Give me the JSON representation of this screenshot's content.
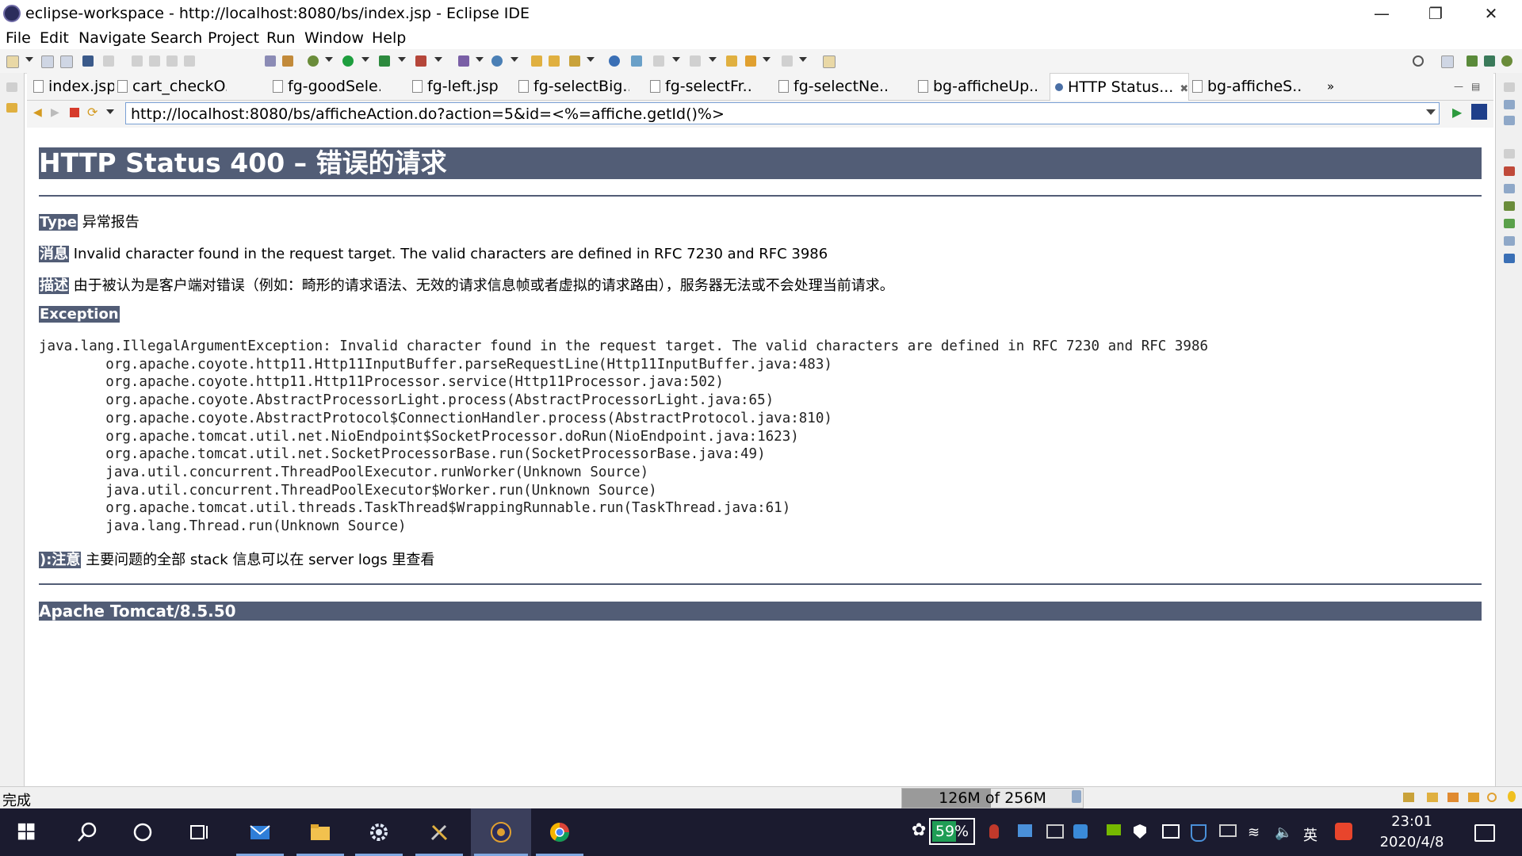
{
  "window": {
    "title": "eclipse-workspace - http://localhost:8080/bs/index.jsp - Eclipse IDE"
  },
  "menu": [
    "File",
    "Edit",
    "Navigate",
    "Search",
    "Project",
    "Run",
    "Window",
    "Help"
  ],
  "tabs": [
    {
      "label": "index.jsp",
      "active": false
    },
    {
      "label": "cart_checkO...",
      "active": false
    },
    {
      "label": "fg-goodSele...",
      "active": false
    },
    {
      "label": "fg-left.jsp",
      "active": false
    },
    {
      "label": "fg-selectBig...",
      "active": false
    },
    {
      "label": "fg-selectFr...",
      "active": false
    },
    {
      "label": "fg-selectNe...",
      "active": false
    },
    {
      "label": "bg-afficheUp...",
      "active": false
    },
    {
      "label": "HTTP Status...",
      "active": true
    },
    {
      "label": "bg-afficheS...",
      "active": false
    }
  ],
  "tab_overflow": "»",
  "browser": {
    "url": "http://localhost:8080/bs/afficheAction.do?action=5&id=<%=affiche.getId()%>"
  },
  "page": {
    "heading": "HTTP Status 400 – 错误的请求",
    "type_label": "Type",
    "type_value": "异常报告",
    "message_label": "消息",
    "message_value": "Invalid character found in the request target. The valid characters are defined in RFC 7230 and RFC 3986",
    "desc_label": "描述",
    "desc_value": "由于被认为是客户端对错误（例如：畸形的请求语法、无效的请求信息帧或者虚拟的请求路由），服务器无法或不会处理当前请求。",
    "exception_label": "Exception",
    "stack": [
      "java.lang.IllegalArgumentException: Invalid character found in the request target. The valid characters are defined in RFC 7230 and RFC 3986",
      "\torg.apache.coyote.http11.Http11InputBuffer.parseRequestLine(Http11InputBuffer.java:483)",
      "\torg.apache.coyote.http11.Http11Processor.service(Http11Processor.java:502)",
      "\torg.apache.coyote.AbstractProcessorLight.process(AbstractProcessorLight.java:65)",
      "\torg.apache.coyote.AbstractProtocol$ConnectionHandler.process(AbstractProtocol.java:810)",
      "\torg.apache.tomcat.util.net.NioEndpoint$SocketProcessor.doRun(NioEndpoint.java:1623)",
      "\torg.apache.tomcat.util.net.SocketProcessorBase.run(SocketProcessorBase.java:49)",
      "\tjava.util.concurrent.ThreadPoolExecutor.runWorker(Unknown Source)",
      "\tjava.util.concurrent.ThreadPoolExecutor$Worker.run(Unknown Source)",
      "\torg.apache.tomcat.util.threads.TaskThread$WrappingRunnable.run(TaskThread.java:61)",
      "\tjava.lang.Thread.run(Unknown Source)"
    ],
    "note_label": "):注意",
    "note_value": "主要问题的全部 stack 信息可以在 server logs 里查看",
    "footer": "Apache Tomcat/8.5.50"
  },
  "status": {
    "text": "完成",
    "memory": "126M of 256M",
    "memory_fraction": 0.49
  },
  "taskbar": {
    "battery": "59%",
    "battery_fraction": 0.59,
    "ime": "英",
    "time": "23:01",
    "date": "2020/4/8"
  },
  "icons": {
    "start": "windows-start-icon",
    "search": "search-icon",
    "cortana": "cortana-icon",
    "taskview": "task-view-icon"
  }
}
